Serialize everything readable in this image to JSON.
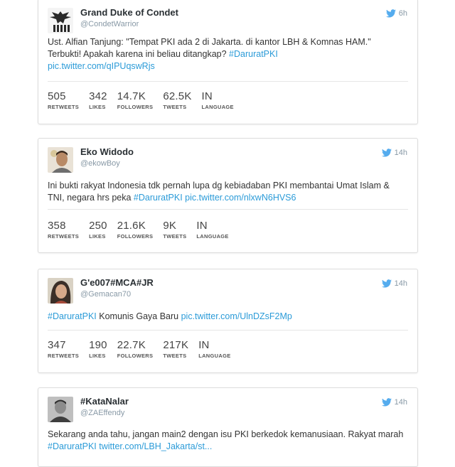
{
  "tweets": [
    {
      "name": "Grand Duke of Condet",
      "handle": "@CondetWarrior",
      "time": "6h",
      "text_parts": [
        "Ust. Alfian Tanjung: \"Tempat PKI ada 2 di Jakarta. di kantor LBH & Komnas HAM.\" Terbukti! Apakah karena ini beliau ditangkap? ",
        "#DaruratPKI",
        "pic.twitter.com/qIPUqswRjs"
      ],
      "stats": [
        {
          "num": "505",
          "label": "RETWEETS"
        },
        {
          "num": "342",
          "label": "LIKES"
        },
        {
          "num": "14.7K",
          "label": "FOLLOWERS"
        },
        {
          "num": "62.5K",
          "label": "TWEETS"
        },
        {
          "num": "IN",
          "label": "LANGUAGE"
        }
      ]
    },
    {
      "name": "Eko Widodo",
      "handle": "@ekowBoy",
      "time": "14h",
      "text_parts": [
        "Ini bukti rakyat Indonesia tdk pernah lupa dg kebiadaban PKI membantai Umat Islam & TNI, negara hrs peka ",
        "#DaruratPKI",
        "pic.twitter.com/nlxwN6HVS6"
      ],
      "stats": [
        {
          "num": "358",
          "label": "RETWEETS"
        },
        {
          "num": "250",
          "label": "LIKES"
        },
        {
          "num": "21.6K",
          "label": "FOLLOWERS"
        },
        {
          "num": "9K",
          "label": "TWEETS"
        },
        {
          "num": "IN",
          "label": "LANGUAGE"
        }
      ]
    },
    {
      "name": "G'e007#MCA#JR",
      "handle": "@Gemacan70",
      "time": "14h",
      "text_parts": [
        "",
        "#DaruratPKI",
        " Komunis Gaya Baru ",
        "pic.twitter.com/UlnDZsF2Mp"
      ],
      "stats": [
        {
          "num": "347",
          "label": "RETWEETS"
        },
        {
          "num": "190",
          "label": "LIKES"
        },
        {
          "num": "22.7K",
          "label": "FOLLOWERS"
        },
        {
          "num": "217K",
          "label": "TWEETS"
        },
        {
          "num": "IN",
          "label": "LANGUAGE"
        }
      ]
    },
    {
      "name": "#KataNalar",
      "handle": "@ZAEffendy",
      "time": "14h",
      "text_parts": [
        "Sekarang anda tahu, jangan main2 dengan isu PKI berkedok kemanusiaan. Rakyat marah ",
        "#DaruratPKI",
        " twitter.com/LBH_Jakarta/st..."
      ]
    }
  ],
  "colors": {
    "link": "#2b9bd8",
    "bird": "#55acee"
  }
}
